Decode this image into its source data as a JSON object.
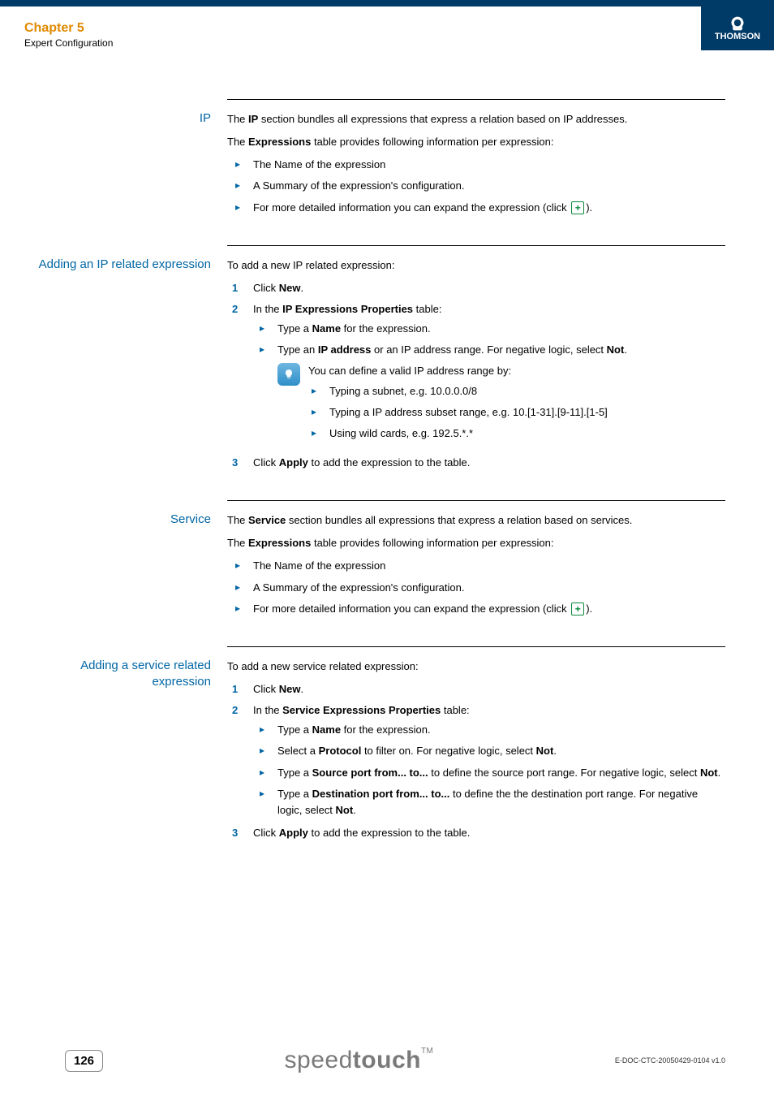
{
  "header": {
    "chapter": "Chapter 5",
    "subtitle": "Expert Configuration",
    "brand": "THOMSON"
  },
  "sections": {
    "ip": {
      "label": "IP",
      "p1a": "The ",
      "p1b": "IP",
      "p1c": " section bundles all expressions that express a relation based on IP addresses.",
      "p2a": "The ",
      "p2b": "Expressions",
      "p2c": " table provides following information per expression:",
      "li1": "The Name of the expression",
      "li2": "A Summary of the expression's configuration.",
      "li3a": "For more detailed information you can expand the expression (click ",
      "li3b": ")."
    },
    "addip": {
      "label": "Adding an IP related expression",
      "intro": "To add a new IP related expression:",
      "s1a": "Click ",
      "s1b": "New",
      "s1c": ".",
      "s2a": "In the ",
      "s2b": "IP Expressions Properties",
      "s2c": " table:",
      "s2li1a": "Type a ",
      "s2li1b": "Name",
      "s2li1c": " for the expression.",
      "s2li2a": "Type an ",
      "s2li2b": "IP address",
      "s2li2c": " or an IP address range. For negative logic, select ",
      "s2li2d": "Not",
      "s2li2e": ".",
      "tip_intro": "You can define a valid IP address range by:",
      "tip1": "Typing a subnet, e.g. 10.0.0.0/8",
      "tip2": "Typing a IP address subset range, e.g. 10.[1-31].[9-11].[1-5]",
      "tip3": "Using wild cards, e.g. 192.5.*.*",
      "s3a": "Click ",
      "s3b": "Apply",
      "s3c": " to add the expression to the table."
    },
    "service": {
      "label": "Service",
      "p1a": "The ",
      "p1b": "Service",
      "p1c": " section bundles all expressions that express a relation based on services.",
      "p2a": "The ",
      "p2b": "Expressions",
      "p2c": " table provides following information per expression:",
      "li1": "The Name of the expression",
      "li2": "A Summary of the expression's configuration.",
      "li3a": "For more detailed information you can expand the expression (click ",
      "li3b": ")."
    },
    "addservice": {
      "label": "Adding a service related expression",
      "intro": "To add a new service related expression:",
      "s1a": "Click ",
      "s1b": "New",
      "s1c": ".",
      "s2a": "In the ",
      "s2b": "Service Expressions Properties",
      "s2c": " table:",
      "s2li1a": "Type a ",
      "s2li1b": "Name",
      "s2li1c": " for the expression.",
      "s2li2a": "Select a ",
      "s2li2b": "Protocol",
      "s2li2c": " to filter on. For negative logic, select ",
      "s2li2d": "Not",
      "s2li2e": ".",
      "s2li3a": "Type a ",
      "s2li3b": "Source port from... to...",
      "s2li3c": " to define the source port range. For negative logic, select ",
      "s2li3d": "Not",
      "s2li3e": ".",
      "s2li4a": "Type a ",
      "s2li4b": "Destination port from... to...",
      "s2li4c": " to define the the destination port range. For negative logic, select ",
      "s2li4d": "Not",
      "s2li4e": ".",
      "s3a": "Click ",
      "s3b": "Apply",
      "s3c": " to add the expression to the table."
    }
  },
  "footer": {
    "page": "126",
    "logo1": "speed",
    "logo2": "touch",
    "tm": "TM",
    "docref": "E-DOC-CTC-20050429-0104 v1.0"
  },
  "icons": {
    "plus": "+"
  }
}
